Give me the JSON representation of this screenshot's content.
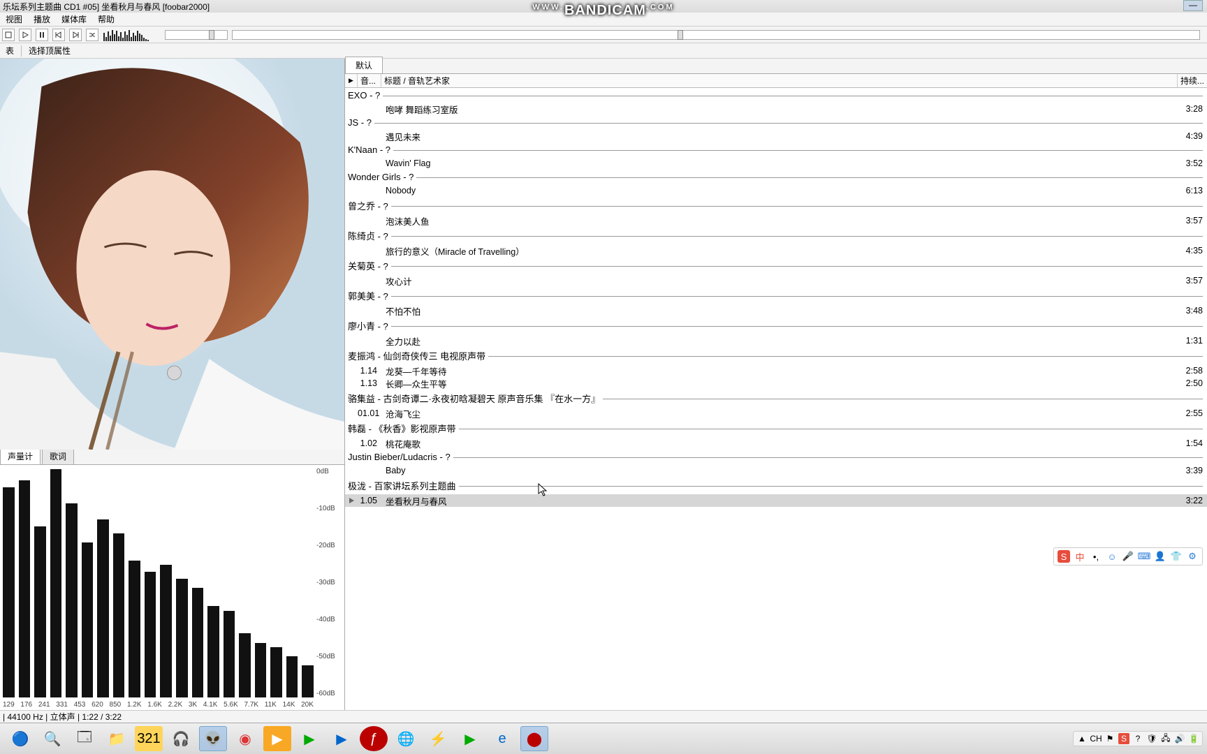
{
  "title": "乐坛系列主题曲 CD1 #05] 坐看秋月与春风  [foobar2000]",
  "menu": {
    "view": "视图",
    "play": "播放",
    "library": "媒体库",
    "help": "帮助"
  },
  "subbar": {
    "left": "表",
    "right": "选择顶属性"
  },
  "right": {
    "tab": "默认",
    "columns": {
      "play": "▶",
      "num": "音...",
      "title": "标题 / 音轨艺术家",
      "duration": "持续..."
    }
  },
  "playlist": [
    {
      "group": "EXO - ?",
      "tracks": [
        {
          "num": "",
          "title": "咆哮 舞蹈练习室版",
          "dur": "3:28"
        }
      ]
    },
    {
      "group": "JS - ?",
      "tracks": [
        {
          "num": "",
          "title": "遇见未来",
          "dur": "4:39"
        }
      ]
    },
    {
      "group": "K'Naan - ?",
      "tracks": [
        {
          "num": "",
          "title": "Wavin' Flag",
          "dur": "3:52"
        }
      ]
    },
    {
      "group": "Wonder Girls - ?",
      "tracks": [
        {
          "num": "",
          "title": "Nobody",
          "dur": "6:13"
        }
      ]
    },
    {
      "group": "曾之乔 - ?",
      "tracks": [
        {
          "num": "",
          "title": "泡沫美人鱼",
          "dur": "3:57"
        }
      ]
    },
    {
      "group": "陈绮贞 - ?",
      "tracks": [
        {
          "num": "",
          "title": "旅行的意义（Miracle of Travelling）",
          "dur": "4:35"
        }
      ]
    },
    {
      "group": "关菊英 - ?",
      "tracks": [
        {
          "num": "",
          "title": "攻心计",
          "dur": "3:57"
        }
      ]
    },
    {
      "group": "郭美美 - ?",
      "tracks": [
        {
          "num": "",
          "title": "不怕不怕",
          "dur": "3:48"
        }
      ]
    },
    {
      "group": "廖小青 - ?",
      "tracks": [
        {
          "num": "",
          "title": "全力以赴",
          "dur": "1:31"
        }
      ]
    },
    {
      "group": "麦振鸿 - 仙剑奇侠传三 电视原声带",
      "tracks": [
        {
          "num": "1.14",
          "title": "龙葵—千年等待",
          "dur": "2:58"
        },
        {
          "num": "1.13",
          "title": "长卿—众生平等",
          "dur": "2:50"
        }
      ]
    },
    {
      "group": "骆集益 - 古剑奇谭二·永夜初晗凝碧天 原声音乐集 『在水一方』",
      "tracks": [
        {
          "num": "01.01",
          "title": "沧海飞尘",
          "dur": "2:55"
        }
      ]
    },
    {
      "group": "韩磊 - 《秋香》影视原声带",
      "tracks": [
        {
          "num": "1.02",
          "title": "桃花庵歌",
          "dur": "1:54"
        }
      ]
    },
    {
      "group": "Justin Bieber/Ludacris - ?",
      "tracks": [
        {
          "num": "",
          "title": "Baby",
          "dur": "3:39"
        }
      ]
    },
    {
      "group": "极泷 - 百家讲坛系列主题曲",
      "tracks": [
        {
          "num": "1.05",
          "title": "坐看秋月与春风",
          "dur": "3:22",
          "playing": true
        }
      ]
    }
  ],
  "bottom_tabs": {
    "level": "声量计",
    "lyrics": "歌词"
  },
  "eq": {
    "bars": [
      92,
      95,
      75,
      100,
      85,
      68,
      78,
      72,
      60,
      55,
      58,
      52,
      48,
      40,
      38,
      28,
      24,
      22,
      18,
      14
    ],
    "y_labels": [
      "0dB",
      "-10dB",
      "-20dB",
      "-30dB",
      "-40dB",
      "-50dB",
      "-60dB"
    ],
    "x_labels": [
      "129",
      "176",
      "241",
      "331",
      "453",
      "620",
      "850",
      "1.2K",
      "1.6K",
      "2.2K",
      "3K",
      "4.1K",
      "5.6K",
      "7.7K",
      "11K",
      "14K",
      "20K"
    ]
  },
  "status": {
    "codec_bits": "| 44100 Hz | 立体声 | 1:22 / 3:22"
  },
  "watermark": "www.BANDICAM.com",
  "taskbar_icons": [
    "start",
    "search",
    "folder",
    "explorer",
    "mpc",
    "headphones",
    "alien",
    "netease",
    "player",
    "iqiyi",
    "youku",
    "flash",
    "chrome",
    "thunder",
    "play",
    "ie",
    "record"
  ],
  "colors": {
    "accent": "#2b7bd9"
  }
}
